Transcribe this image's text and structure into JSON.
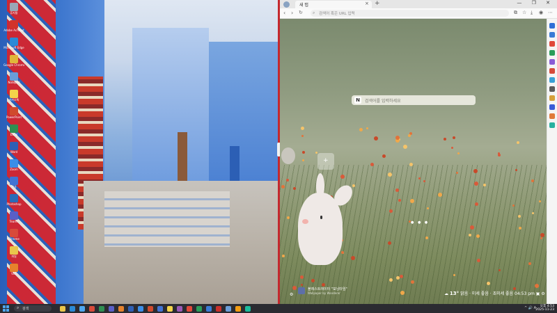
{
  "desktop": {
    "icons": [
      {
        "label": "휴지통",
        "color": "#9aa7b6"
      },
      {
        "label": "Adobe Acrobat",
        "color": "#d2332b"
      },
      {
        "label": "Microsoft Edge",
        "color": "#2c8ad6"
      },
      {
        "label": "Google Chrome",
        "color": "#e0b63a"
      },
      {
        "label": "Notepad",
        "color": "#6b9ed9"
      },
      {
        "label": "카카오톡",
        "color": "#f3d34a"
      },
      {
        "label": "PowerPoint",
        "color": "#d04a2d"
      },
      {
        "label": "Excel",
        "color": "#2f8f52"
      },
      {
        "label": "Word",
        "color": "#2f5fb5"
      },
      {
        "label": "Zoom",
        "color": "#3b8ee8"
      },
      {
        "label": "한글",
        "color": "#4173d3"
      },
      {
        "label": "Photoshop",
        "color": "#2a6cb8"
      },
      {
        "label": "Teams",
        "color": "#5a5fc7"
      },
      {
        "label": "Chrome",
        "color": "#d84a3a"
      },
      {
        "label": "파일",
        "color": "#e9c54b"
      },
      {
        "label": "VLC",
        "color": "#e6822c"
      }
    ]
  },
  "browser": {
    "tab_title": "새 탭",
    "tab_close": "×",
    "new_tab": "+",
    "window_controls": "— ❐ ✕",
    "address_placeholder": "검색어 혹은 URL 입력",
    "search_placeholder": "검색어를 입력하세요",
    "shortcut_icon": "+",
    "carousel_dots": "● ● ●",
    "news": {
      "title": "블레스트레이터 \"모닝타임\"",
      "subtitle": "Wallpaper by Wanderer"
    },
    "weather": {
      "temp": "13°",
      "text": "맑음 · 미세 좋음 · 초미세 좋음",
      "time": "04:53 pm"
    },
    "sidebar_colors": [
      "#2f6fd6",
      "#3a7bd5",
      "#e0483a",
      "#2a9d5a",
      "#8a5bd6",
      "#d64a3a",
      "#3aa0d6",
      "#5b5b5b",
      "#d6a03a",
      "#3a5bd6",
      "#e07a3a",
      "#2ab0a0"
    ]
  },
  "page_colors": {
    "flowers": [
      "#e2733a",
      "#f0a84a",
      "#d95a3a",
      "#f5c46a",
      "#c84a2a"
    ]
  },
  "taskbar": {
    "search_icon": "⌕",
    "search_text": "검색",
    "apps": [
      "#e9c54b",
      "#2c8ad6",
      "#4fa7ef",
      "#d84a3a",
      "#2f8f52",
      "#5a5fc7",
      "#e6822c",
      "#2f5fb5",
      "#3b8ee8",
      "#d04a2d",
      "#4173d3",
      "#f3d34a",
      "#9b59b6",
      "#e0483a",
      "#2a9d5a",
      "#3a7bd5",
      "#c9302c",
      "#6b9ed9",
      "#f39c12",
      "#1abc9c"
    ],
    "tray": "^ 🔊 A",
    "time": "오후 4:53",
    "date": "2025-11-23"
  }
}
